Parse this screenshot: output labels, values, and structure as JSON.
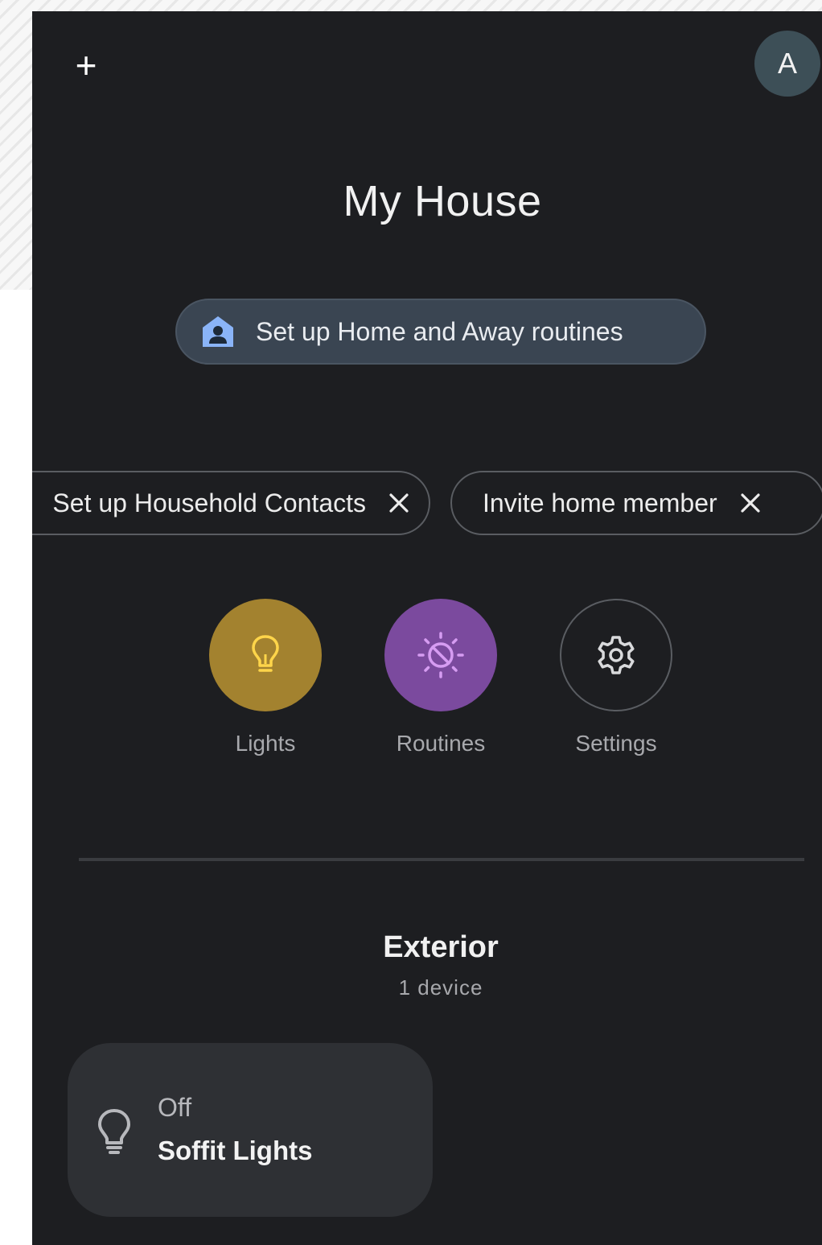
{
  "header": {
    "add_label": "+",
    "avatar_initial": "A"
  },
  "home": {
    "title": "My House"
  },
  "suggestions": {
    "routines_chip": "Set up Home and Away routines",
    "contacts_chip": "Set up Household Contacts",
    "invite_chip": "Invite home member"
  },
  "shortcuts": [
    {
      "label": "Lights",
      "icon": "lightbulb-icon",
      "color": "#a3822f"
    },
    {
      "label": "Routines",
      "icon": "routines-icon",
      "color": "#7b4a9e"
    },
    {
      "label": "Settings",
      "icon": "gear-icon",
      "color": "#1d1e21"
    }
  ],
  "room": {
    "name": "Exterior",
    "count": "1 device"
  },
  "device": {
    "state": "Off",
    "name": "Soffit Lights",
    "icon": "lightbulb-icon"
  },
  "colors": {
    "background": "#1d1e21",
    "card": "#2e3034",
    "routines_chip_bg": "#3a4552",
    "home_icon": "#8ab4f8"
  }
}
